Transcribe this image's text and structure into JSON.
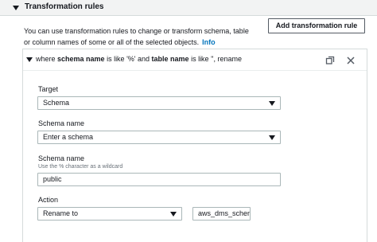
{
  "section": {
    "title": "Transformation rules",
    "description": "You can use transformation rules to change or transform schema, table or column names of some or all of the selected objects.",
    "info_link": "Info",
    "add_button": "Add transformation rule"
  },
  "rule": {
    "title_prefix": "where ",
    "title_schema_label": "schema name",
    "title_mid1": " is like '%' and ",
    "title_table_label": "table name",
    "title_suffix": " is like '', rename"
  },
  "form": {
    "target": {
      "label": "Target",
      "value": "Schema"
    },
    "schema_select": {
      "label": "Schema name",
      "value": "Enter a schema"
    },
    "schema_input": {
      "label": "Schema name",
      "hint": "Use the % character as a wildcard",
      "value": "public"
    },
    "action": {
      "label": "Action",
      "value": "Rename to",
      "rename_value": "aws_dms_schem"
    }
  },
  "icons": {
    "section_toggle": "caret-down-icon",
    "rule_toggle": "caret-down-icon",
    "copy": "copy-icon",
    "remove": "close-icon"
  }
}
